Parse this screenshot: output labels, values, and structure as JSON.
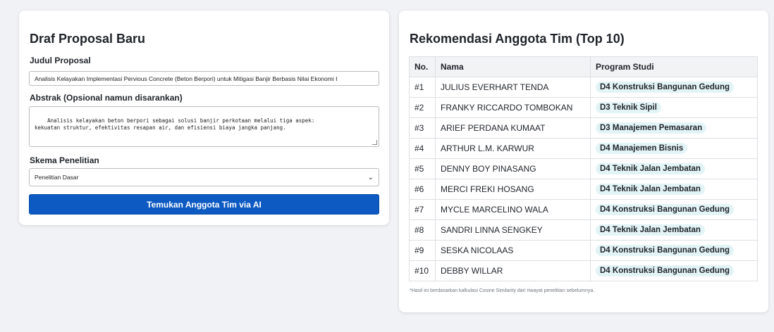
{
  "form": {
    "title": "Draf Proposal Baru",
    "judul_label": "Judul Proposal",
    "judul_value": "Analisis Kelayakan Implementasi Pervious Concrete (Beton Berpori) untuk Mitigasi Banjir Berbasis Nilai Ekonomi I",
    "abstrak_label": "Abstrak (Opsional namun disarankan)",
    "abstrak_value": "Analisis kelayakan beton berpori sebagai solusi banjir perkotaan melalui tiga aspek:\nkekuatan struktur, efektivitas resapan air, dan efisiensi biaya jangka panjang.",
    "skema_label": "Skema Penelitian",
    "skema_value": "Penelitian Dasar",
    "submit_label": "Temukan Anggota Tim via AI"
  },
  "recommendations": {
    "title": "Rekomendasi Anggota Tim (Top 10)",
    "headers": {
      "no": "No.",
      "nama": "Nama",
      "prodi": "Program Studi"
    },
    "rows": [
      {
        "no": "#1",
        "nama": "JULIUS EVERHART TENDA",
        "prodi": "D4 Konstruksi Bangunan Gedung"
      },
      {
        "no": "#2",
        "nama": "FRANKY RICCARDO TOMBOKAN",
        "prodi": "D3 Teknik Sipil"
      },
      {
        "no": "#3",
        "nama": "ARIEF PERDANA KUMAAT",
        "prodi": "D3 Manajemen Pemasaran"
      },
      {
        "no": "#4",
        "nama": "ARTHUR L.M. KARWUR",
        "prodi": "D4 Manajemen Bisnis"
      },
      {
        "no": "#5",
        "nama": "DENNY BOY PINASANG",
        "prodi": "D4 Teknik Jalan Jembatan"
      },
      {
        "no": "#6",
        "nama": "MERCI FREKI HOSANG",
        "prodi": "D4 Teknik Jalan Jembatan"
      },
      {
        "no": "#7",
        "nama": "MYCLE MARCELINO WALA",
        "prodi": "D4 Konstruksi Bangunan Gedung"
      },
      {
        "no": "#8",
        "nama": "SANDRI LINNA SENGKEY",
        "prodi": "D4 Teknik Jalan Jembatan"
      },
      {
        "no": "#9",
        "nama": "SESKA NICOLAAS",
        "prodi": "D4 Konstruksi Bangunan Gedung"
      },
      {
        "no": "#10",
        "nama": "DEBBY WILLAR",
        "prodi": "D4 Konstruksi Bangunan Gedung"
      }
    ],
    "footnote": "*Hasil ini berdasarkan kalkulasi Cosine Similarity dari riwayat penelitian sebelumnya."
  },
  "colors": {
    "primary_button": "#0d5ac2",
    "badge_bg": "#e3f4f7",
    "page_bg": "#f1f2f5"
  }
}
